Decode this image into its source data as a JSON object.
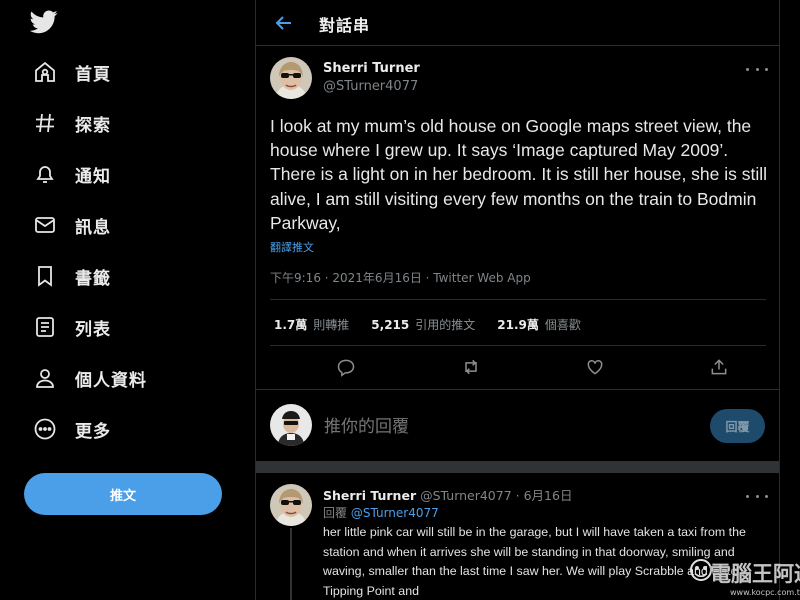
{
  "sidebar": {
    "logo": "twitter-bird-icon",
    "items": [
      {
        "icon": "home-icon",
        "label": "首頁"
      },
      {
        "icon": "hashtag-icon",
        "label": "探索"
      },
      {
        "icon": "bell-icon",
        "label": "通知"
      },
      {
        "icon": "mail-icon",
        "label": "訊息"
      },
      {
        "icon": "bookmark-icon",
        "label": "書籤"
      },
      {
        "icon": "list-icon",
        "label": "列表"
      },
      {
        "icon": "person-icon",
        "label": "個人資料"
      },
      {
        "icon": "more-circle-icon",
        "label": "更多"
      }
    ],
    "tweet_button": "推文"
  },
  "header": {
    "title": "對話串"
  },
  "tweet": {
    "author_name": "Sherri Turner",
    "author_handle": "@STurner4077",
    "text": "I look at my mum’s old house on Google maps street view, the house where I grew up. It says ‘Image captured May 2009’. There is a light on in her bedroom. It is still her house, she is still alive, I am still visiting every few months on the train to Bodmin Parkway,",
    "translate": "翻譯推文",
    "meta": "下午9:16 · 2021年6月16日 · Twitter Web App",
    "stats": [
      {
        "num": "1.7萬",
        "label": "則轉推"
      },
      {
        "num": "5,215",
        "label": "引用的推文"
      },
      {
        "num": "21.9萬",
        "label": "個喜歡"
      }
    ],
    "actions": [
      "reply-icon",
      "retweet-icon",
      "like-icon",
      "share-icon"
    ]
  },
  "reply_box": {
    "placeholder": "推你的回覆",
    "button": "回覆"
  },
  "reply": {
    "author_name": "Sherri Turner",
    "author_handle": "@STurner4077",
    "date": "· 6月16日",
    "replying_prefix": "回覆",
    "replying_to": "@STurner4077",
    "text": "her little pink car will still be in the garage, but I will have taken a taxi from the station and when it arrives she will be standing in that doorway, smiling and waving, smaller than the last time I saw her. We will play Scrabble and watch Tipping Point and"
  },
  "watermark": {
    "text": "電腦王阿達",
    "url": "www.kocpc.com.tw"
  },
  "colors": {
    "accent": "#4b9fe8",
    "background": "#000000",
    "border": "#2b2b2b",
    "muted": "#7f8589"
  }
}
